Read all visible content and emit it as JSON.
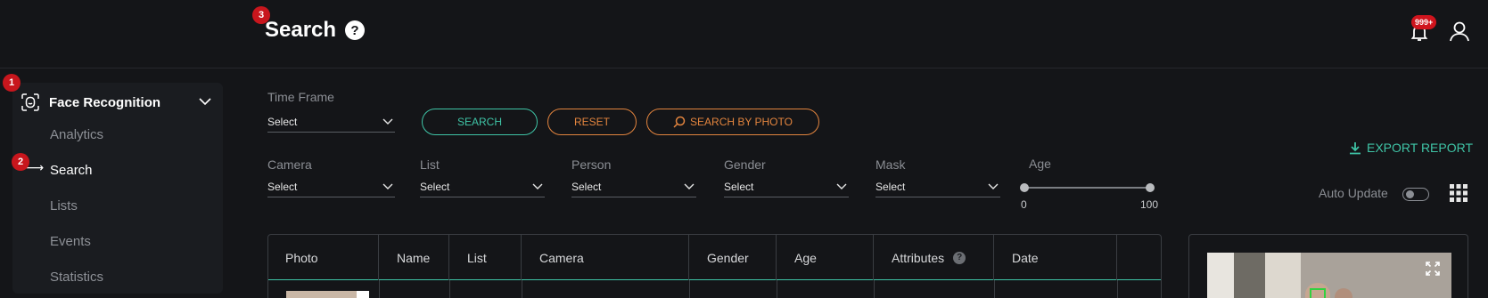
{
  "header": {
    "title": "Search",
    "help_glyph": "?",
    "notifications_count": "999+"
  },
  "step_badges": [
    "1",
    "2",
    "3"
  ],
  "sidebar": {
    "section_title": "Face Recognition",
    "items": [
      {
        "label": "Analytics",
        "active": false
      },
      {
        "label": "Search",
        "active": true
      },
      {
        "label": "Lists",
        "active": false
      },
      {
        "label": "Events",
        "active": false
      },
      {
        "label": "Statistics",
        "active": false
      }
    ]
  },
  "filters": {
    "time_frame": {
      "label": "Time Frame",
      "value": "Select"
    },
    "camera": {
      "label": "Camera",
      "value": "Select"
    },
    "list": {
      "label": "List",
      "value": "Select"
    },
    "person": {
      "label": "Person",
      "value": "Select"
    },
    "gender": {
      "label": "Gender",
      "value": "Select"
    },
    "mask": {
      "label": "Mask",
      "value": "Select"
    },
    "age": {
      "label": "Age",
      "min": "0",
      "max": "100"
    }
  },
  "buttons": {
    "search": "SEARCH",
    "reset": "RESET",
    "search_by_photo": "SEARCH BY PHOTO"
  },
  "toolbar": {
    "export": "EXPORT REPORT",
    "auto_update": "Auto Update",
    "auto_update_on": false
  },
  "table": {
    "columns": [
      "Photo",
      "Name",
      "List",
      "Camera",
      "Gender",
      "Age",
      "Attributes",
      "Date"
    ],
    "attributes_help_glyph": "?"
  },
  "colors": {
    "accent": "#3fc4a6",
    "warning": "#e2843e",
    "badge": "#c8161d",
    "background": "#141518"
  }
}
